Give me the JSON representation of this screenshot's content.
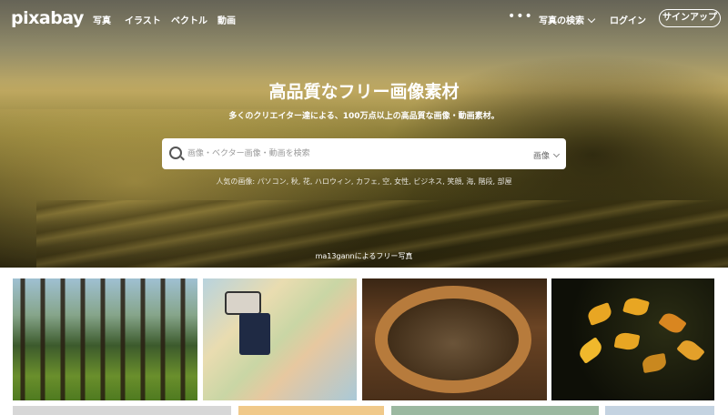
{
  "nav": {
    "logo": "pixabay",
    "links": [
      "写真",
      "イラスト",
      "ベクトル",
      "動画"
    ],
    "more": "•••",
    "explore": "写真の検索",
    "login": "ログイン",
    "signup": "サインアップ"
  },
  "hero": {
    "headline": "高品質なフリー画像素材",
    "subline": "多くのクリエイター達による、100万点以上の高品質な画像・動画素材。",
    "search": {
      "placeholder": "画像・ベクター画像・動画を検索",
      "type": "画像"
    },
    "popular": "人気の画像: パソコン, 秋, 花, ハロウィン, カフェ, 空, 女性, ビジネス, 笑顔, 海, 階段, 部屋",
    "credit": "ma13gannによるフリー写真"
  },
  "icons": {
    "search": "search-icon",
    "chevron": "chevron-down-icon"
  },
  "colors": {
    "accent": "#ffffff",
    "background": "#ffffff"
  }
}
